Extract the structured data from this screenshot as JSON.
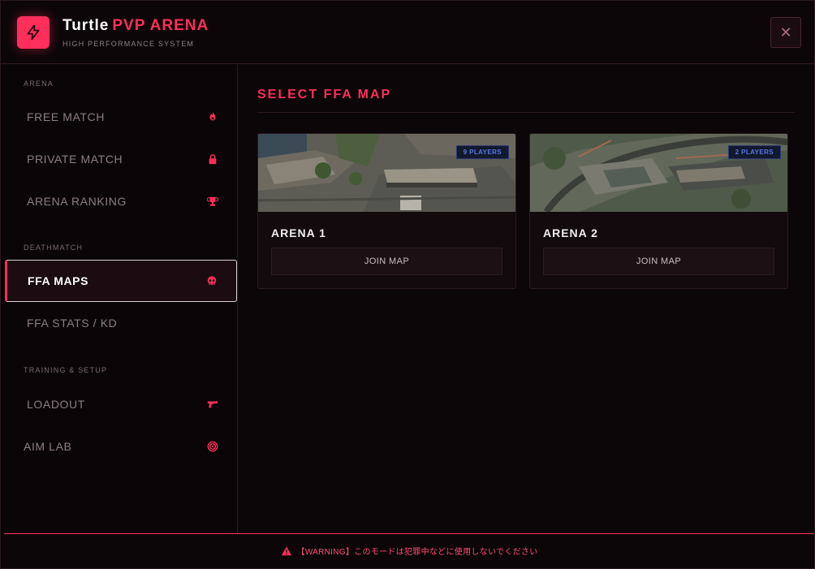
{
  "header": {
    "title_main": "Turtle",
    "title_accent": "PVP ARENA",
    "subtitle": "HIGH PERFORMANCE SYSTEM",
    "logo_icon": "lightning-icon",
    "close_icon": "close-icon",
    "close_glyph": "✕"
  },
  "colors": {
    "accent": "#ff2e5b",
    "background": "#0b0607",
    "badge_text": "#5a78e6"
  },
  "sidebar": {
    "sections": [
      {
        "label": "ARENA",
        "items": [
          {
            "label": "FREE MATCH",
            "icon": "fire-icon"
          },
          {
            "label": "PRIVATE MATCH",
            "icon": "lock-icon"
          },
          {
            "label": "ARENA RANKING",
            "icon": "trophy-icon"
          }
        ]
      },
      {
        "label": "DEATHMATCH",
        "items": [
          {
            "label": "FFA MAPS",
            "icon": "skull-icon",
            "active": true
          },
          {
            "label": "FFA STATS / KD",
            "icon": ""
          }
        ]
      },
      {
        "label": "TRAINING & SETUP",
        "items": [
          {
            "label": "LOADOUT",
            "icon": "gun-icon"
          },
          {
            "label": "AIM LAB",
            "icon": "target-icon"
          }
        ]
      }
    ]
  },
  "main": {
    "title": "SELECT FFA MAP",
    "maps": [
      {
        "name": "ARENA 1",
        "players": "9 PLAYERS",
        "join_label": "JOIN MAP"
      },
      {
        "name": "ARENA 2",
        "players": "2 PLAYERS",
        "join_label": "JOIN MAP"
      }
    ]
  },
  "footer": {
    "warning_icon": "warning-icon",
    "warning_text": "【WARNING】このモードは犯罪中などに使用しないでください"
  }
}
